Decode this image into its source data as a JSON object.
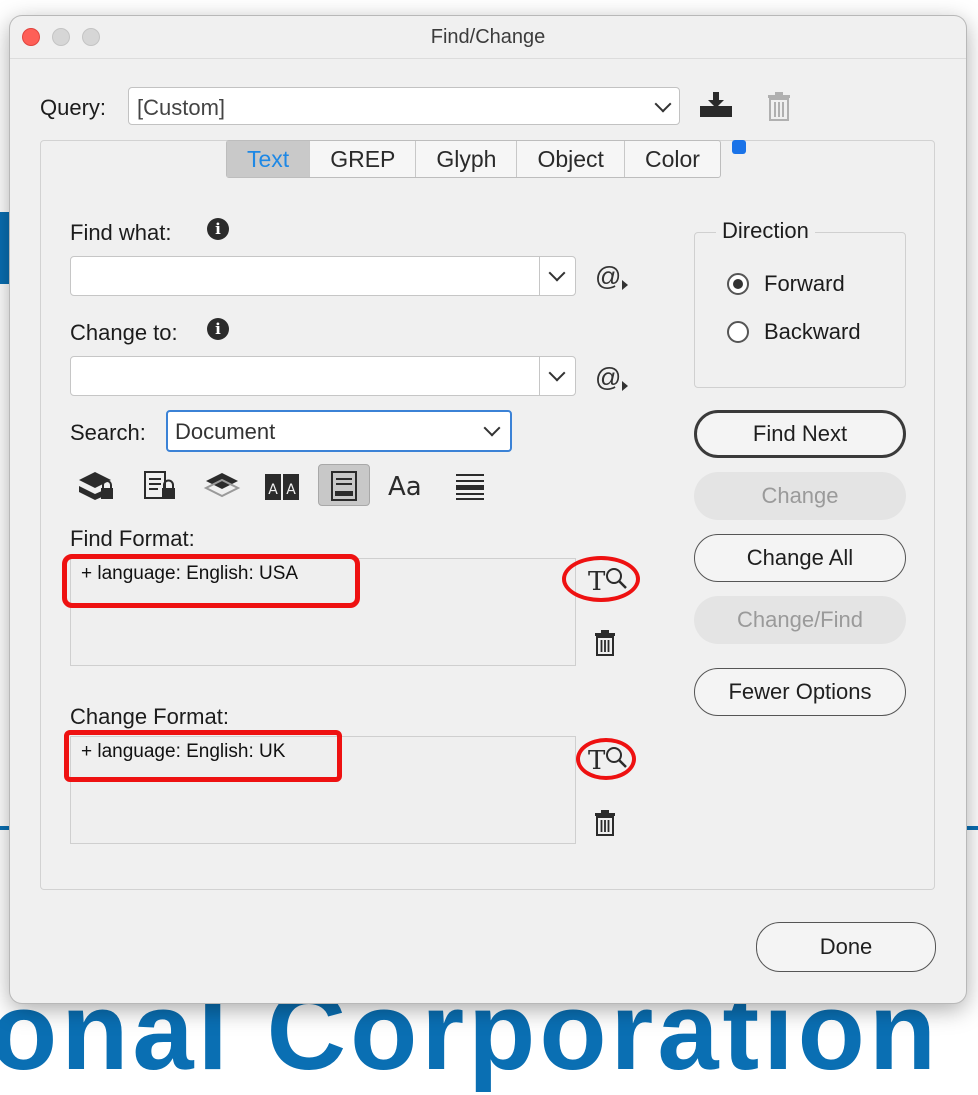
{
  "window": {
    "title": "Find/Change"
  },
  "query": {
    "label": "Query:",
    "value": "[Custom]"
  },
  "tabs": [
    {
      "label": "Text",
      "active": true
    },
    {
      "label": "GREP",
      "active": false
    },
    {
      "label": "Glyph",
      "active": false
    },
    {
      "label": "Object",
      "active": false
    },
    {
      "label": "Color",
      "active": false
    }
  ],
  "find_what": {
    "label": "Find what:",
    "value": ""
  },
  "change_to": {
    "label": "Change to:",
    "value": ""
  },
  "search": {
    "label": "Search:",
    "value": "Document"
  },
  "options_icons": [
    "lock-layers-icon",
    "lock-stories-icon",
    "hidden-layers-icon",
    "master-pages-icon",
    "footnotes-icon",
    "case-sensitive-icon",
    "whole-word-icon"
  ],
  "find_format": {
    "label": "Find Format:",
    "value": "+ language: English: USA"
  },
  "change_format": {
    "label": "Change Format:",
    "value": "+ language: English: UK"
  },
  "direction": {
    "title": "Direction",
    "options": [
      {
        "label": "Forward",
        "checked": true
      },
      {
        "label": "Backward",
        "checked": false
      }
    ]
  },
  "buttons": {
    "find_next": "Find Next",
    "change": "Change",
    "change_all": "Change All",
    "change_find": "Change/Find",
    "fewer_options": "Fewer Options",
    "done": "Done"
  },
  "colors": {
    "accent_blue": "#1e88e5",
    "annotation_red": "#ee1111",
    "close_red": "#fe5f57"
  }
}
